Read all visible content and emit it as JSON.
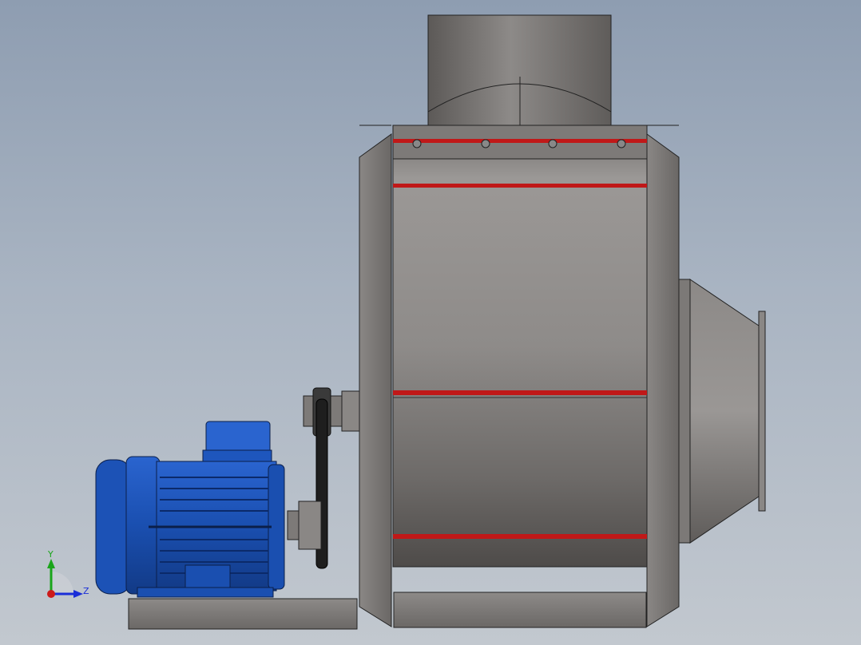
{
  "viewport": {
    "background_top": "#8e9db1",
    "background_bottom": "#c2c8cf"
  },
  "model": {
    "motor_color": "#1a4fb0",
    "housing_color": "#7b7876",
    "accent_color": "#c01818",
    "belt_color": "#1e1e1e"
  },
  "triad": {
    "y_label": "Y",
    "z_label": "Z",
    "y_color": "#1aa51a",
    "z_color": "#1a2ed8",
    "origin_color": "#cc1a1a"
  }
}
